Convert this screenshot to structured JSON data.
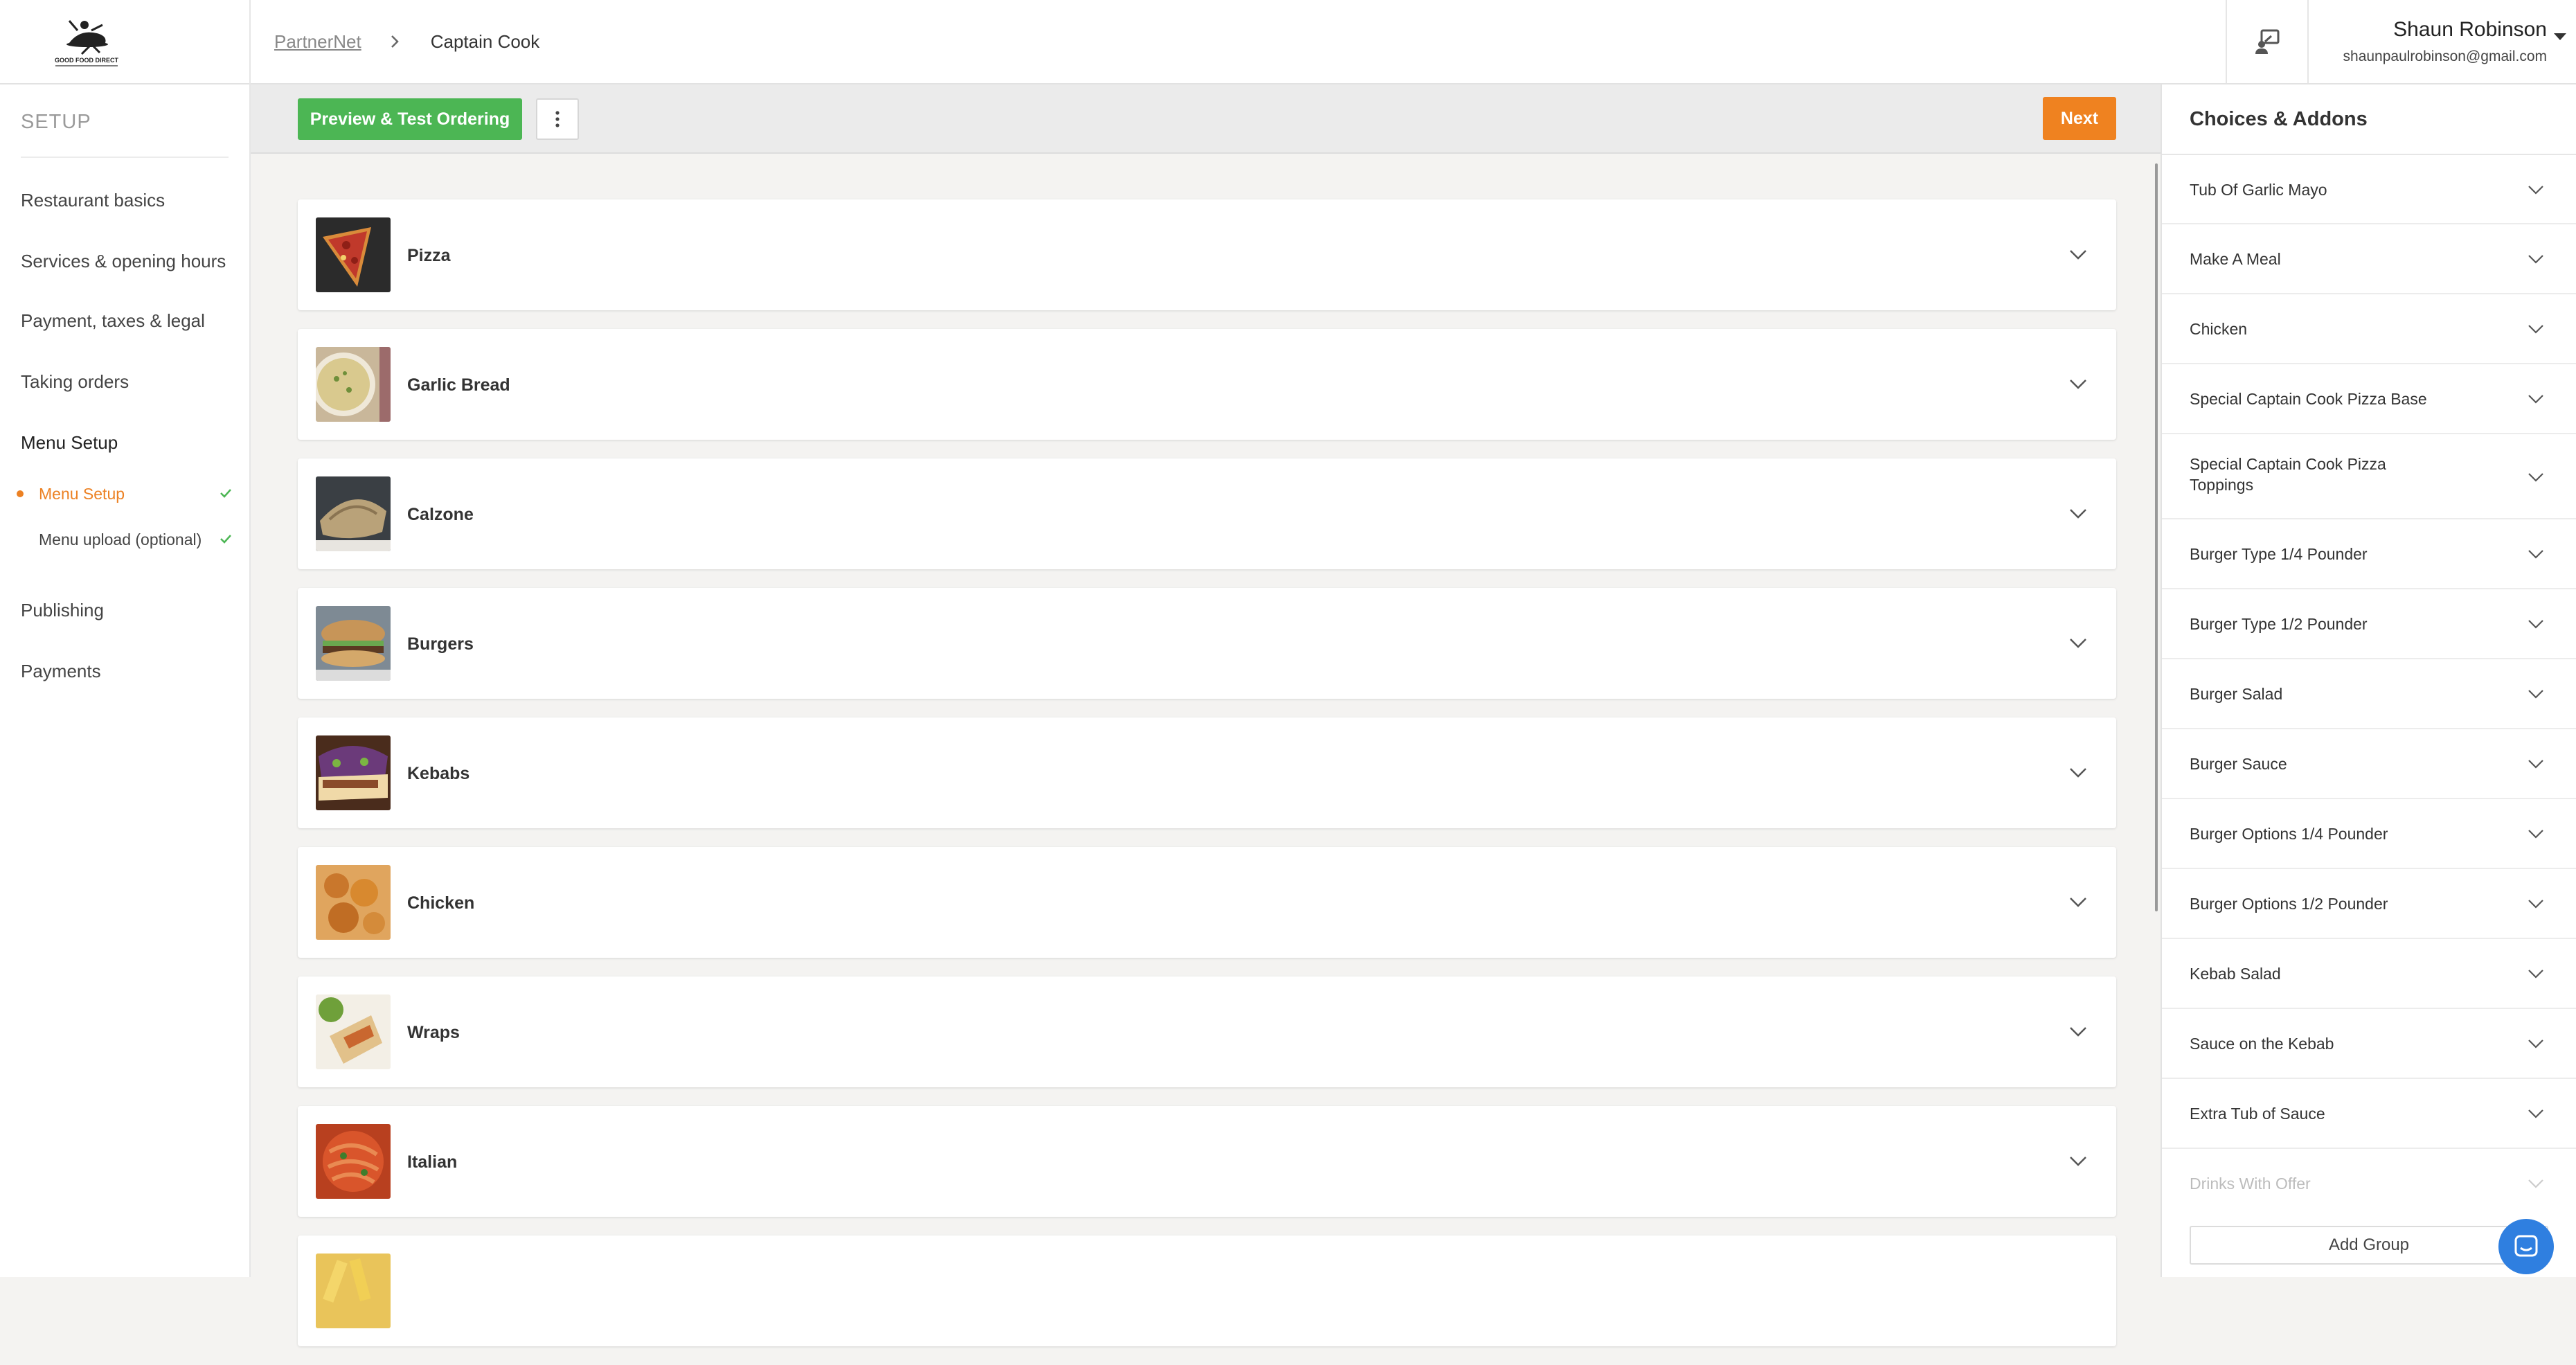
{
  "header": {
    "logo_text": "GOOD FOOD DIRECT",
    "breadcrumb": {
      "root": "PartnerNet",
      "current": "Captain Cook"
    },
    "user": {
      "name": "Shaun Robinson",
      "email": "shaunpaulrobinson@gmail.com"
    }
  },
  "sidebar": {
    "heading": "SETUP",
    "items": [
      {
        "label": "Restaurant basics"
      },
      {
        "label": "Services & opening hours"
      },
      {
        "label": "Payment, taxes & legal"
      },
      {
        "label": "Taking orders"
      },
      {
        "label": "Menu Setup"
      },
      {
        "label": "Publishing"
      },
      {
        "label": "Payments"
      }
    ],
    "subitems": [
      {
        "label": "Menu Setup",
        "active": true,
        "complete": true
      },
      {
        "label": "Menu upload (optional)",
        "active": false,
        "complete": true
      }
    ]
  },
  "toolbar": {
    "preview_label": "Preview & Test Ordering",
    "next_label": "Next"
  },
  "categories": [
    {
      "name": "Pizza",
      "thumb": "pizza"
    },
    {
      "name": "Garlic Bread",
      "thumb": "garlic-bread"
    },
    {
      "name": "Calzone",
      "thumb": "calzone"
    },
    {
      "name": "Burgers",
      "thumb": "burgers"
    },
    {
      "name": "Kebabs",
      "thumb": "kebabs"
    },
    {
      "name": "Chicken",
      "thumb": "chicken"
    },
    {
      "name": "Wraps",
      "thumb": "wraps"
    },
    {
      "name": "Italian",
      "thumb": "italian"
    }
  ],
  "choices_panel": {
    "title": "Choices & Addons",
    "groups": [
      "Tub Of Garlic Mayo",
      "Make A Meal",
      "Chicken",
      "Special Captain Cook Pizza Base",
      "Special Captain Cook Pizza Toppings",
      "Burger Type 1/4 Pounder",
      "Burger Type 1/2 Pounder",
      "Burger Salad",
      "Burger Sauce",
      "Burger Options 1/4 Pounder",
      "Burger Options 1/2 Pounder",
      "Kebab Salad",
      "Sauce on the Kebab",
      "Extra Tub of Sauce",
      "Drinks With Offer"
    ],
    "add_group_label": "Add Group"
  },
  "colors": {
    "accent_orange": "#ef8220",
    "accent_green": "#4cb654",
    "chat_blue": "#2f7fe0"
  }
}
